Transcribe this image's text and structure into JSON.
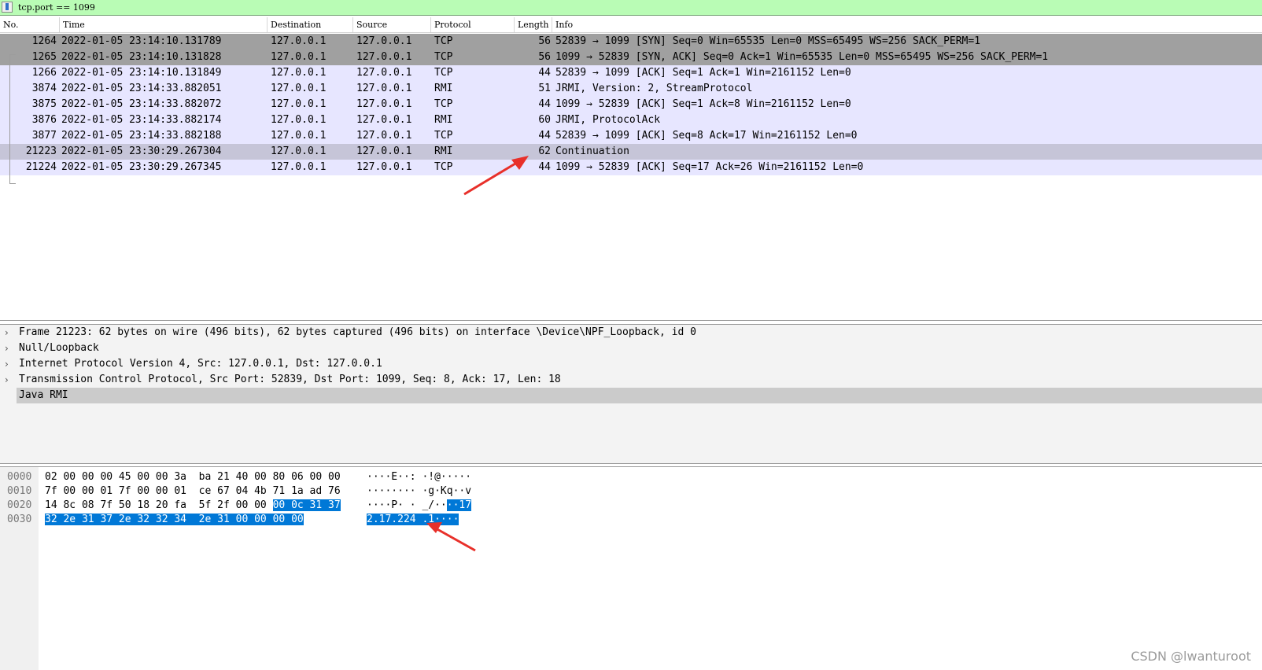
{
  "filter": {
    "value": "tcp.port == 1099"
  },
  "columns": [
    "No.",
    "Time",
    "Destination",
    "Source",
    "Protocol",
    "Length",
    "Info"
  ],
  "packets": [
    {
      "no": "1264",
      "time": "2022-01-05 23:14:10.131789",
      "dst": "127.0.0.1",
      "src": "127.0.0.1",
      "proto": "TCP",
      "len": "56",
      "info": "52839 → 1099 [SYN] Seq=0 Win=65535 Len=0 MSS=65495 WS=256 SACK_PERM=1",
      "bg": "#a0a0a0"
    },
    {
      "no": "1265",
      "time": "2022-01-05 23:14:10.131828",
      "dst": "127.0.0.1",
      "src": "127.0.0.1",
      "proto": "TCP",
      "len": "56",
      "info": "1099 → 52839 [SYN, ACK] Seq=0 Ack=1 Win=65535 Len=0 MSS=65495 WS=256 SACK_PERM=1",
      "bg": "#a0a0a0"
    },
    {
      "no": "1266",
      "time": "2022-01-05 23:14:10.131849",
      "dst": "127.0.0.1",
      "src": "127.0.0.1",
      "proto": "TCP",
      "len": "44",
      "info": "52839 → 1099 [ACK] Seq=1 Ack=1 Win=2161152 Len=0",
      "bg": "#e7e6ff"
    },
    {
      "no": "3874",
      "time": "2022-01-05 23:14:33.882051",
      "dst": "127.0.0.1",
      "src": "127.0.0.1",
      "proto": "RMI",
      "len": "51",
      "info": "JRMI, Version: 2, StreamProtocol",
      "bg": "#e7e6ff"
    },
    {
      "no": "3875",
      "time": "2022-01-05 23:14:33.882072",
      "dst": "127.0.0.1",
      "src": "127.0.0.1",
      "proto": "TCP",
      "len": "44",
      "info": "1099 → 52839 [ACK] Seq=1 Ack=8 Win=2161152 Len=0",
      "bg": "#e7e6ff"
    },
    {
      "no": "3876",
      "time": "2022-01-05 23:14:33.882174",
      "dst": "127.0.0.1",
      "src": "127.0.0.1",
      "proto": "RMI",
      "len": "60",
      "info": "JRMI, ProtocolAck",
      "bg": "#e7e6ff"
    },
    {
      "no": "3877",
      "time": "2022-01-05 23:14:33.882188",
      "dst": "127.0.0.1",
      "src": "127.0.0.1",
      "proto": "TCP",
      "len": "44",
      "info": "52839 → 1099 [ACK] Seq=8 Ack=17 Win=2161152 Len=0",
      "bg": "#e7e6ff"
    },
    {
      "no": "21223",
      "time": "2022-01-05 23:30:29.267304",
      "dst": "127.0.0.1",
      "src": "127.0.0.1",
      "proto": "RMI",
      "len": "62",
      "info": "Continuation",
      "bg": "#c6c5d8"
    },
    {
      "no": "21224",
      "time": "2022-01-05 23:30:29.267345",
      "dst": "127.0.0.1",
      "src": "127.0.0.1",
      "proto": "TCP",
      "len": "44",
      "info": "1099 → 52839 [ACK] Seq=17 Ack=26 Win=2161152 Len=0",
      "bg": "#e7e6ff"
    }
  ],
  "details": [
    {
      "chevron": "›",
      "text": "Frame 21223: 62 bytes on wire (496 bits), 62 bytes captured (496 bits) on interface \\Device\\NPF_Loopback, id 0"
    },
    {
      "chevron": "›",
      "text": "Null/Loopback"
    },
    {
      "chevron": "›",
      "text": "Internet Protocol Version 4, Src: 127.0.0.1, Dst: 127.0.0.1"
    },
    {
      "chevron": "›",
      "text": "Transmission Control Protocol, Src Port: 52839, Dst Port: 1099, Seq: 8, Ack: 17, Len: 18"
    },
    {
      "chevron": "",
      "text": "Java RMI",
      "selected": true
    }
  ],
  "bytes": [
    {
      "offset": "0000",
      "hex_plain": "02 00 00 00 45 00 00 3a  ba 21 40 00 80 06 00 00",
      "hex_hl": "",
      "ascii_plain": "····E··: ·!@·····",
      "ascii_hl": ""
    },
    {
      "offset": "0010",
      "hex_plain": "7f 00 00 01 7f 00 00 01  ce 67 04 4b 71 1a ad 76",
      "hex_hl": "",
      "ascii_plain": "········ ·g·Kq··v",
      "ascii_hl": ""
    },
    {
      "offset": "0020",
      "hex_plain": "14 8c 08 7f 50 18 20 fa  5f 2f 00 00 ",
      "hex_hl": "00 0c 31 37",
      "ascii_plain": "····P· · _/··",
      "ascii_hl": "··17"
    },
    {
      "offset": "0030",
      "hex_plain": "",
      "hex_hl": "32 2e 31 37 2e 32 32 34  2e 31 00 00 00 00",
      "ascii_plain": "",
      "ascii_hl": "2.17.224 .1····"
    }
  ],
  "watermark": "CSDN @lwanturoot"
}
